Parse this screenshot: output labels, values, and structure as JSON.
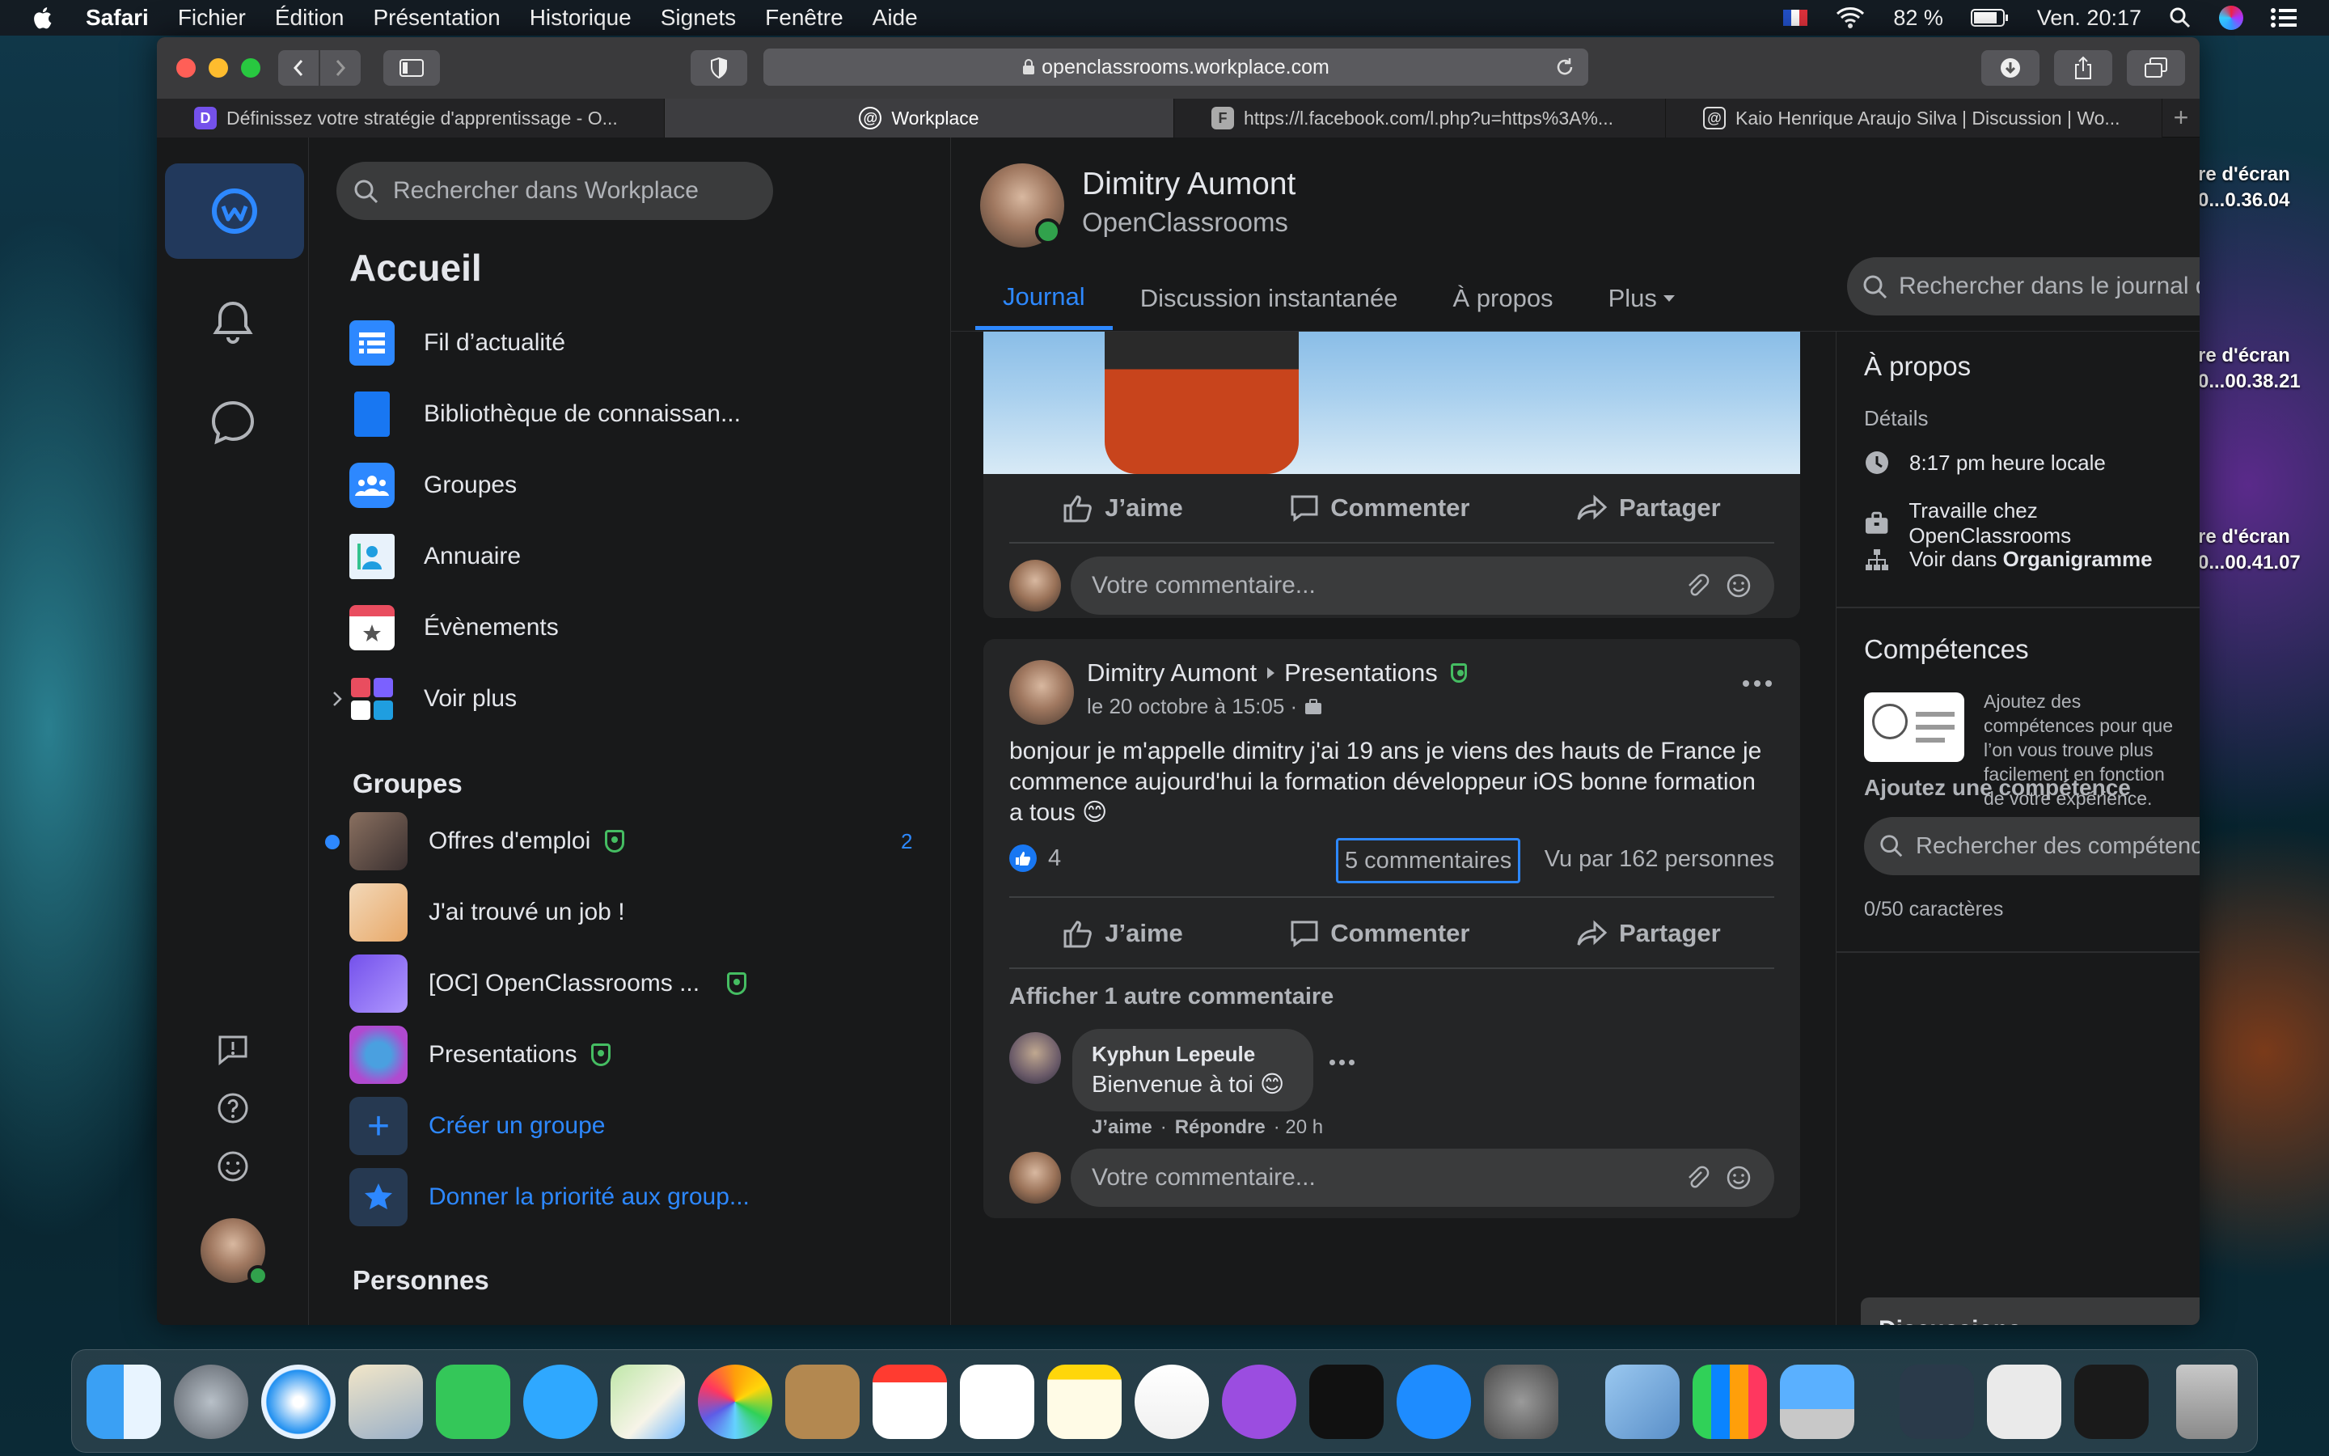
{
  "menubar": {
    "app": "Safari",
    "items": [
      "Fichier",
      "Édition",
      "Présentation",
      "Historique",
      "Signets",
      "Fenêtre",
      "Aide"
    ],
    "battery": "82 %",
    "clock": "Ven. 20:17"
  },
  "browser": {
    "url": "openclassrooms.workplace.com",
    "tabs": [
      {
        "label": "Définissez votre stratégie d'apprentissage - O...",
        "icon": "openclassrooms-favicon",
        "active": false
      },
      {
        "label": "Workplace",
        "icon": "workplace-favicon",
        "active": true
      },
      {
        "label": "https://l.facebook.com/l.php?u=https%3A%...",
        "icon": "facebook-favicon",
        "active": false
      },
      {
        "label": "Kaio Henrique Araujo Silva | Discussion | Wo...",
        "icon": "workplace-favicon",
        "active": false
      }
    ]
  },
  "left": {
    "search_placeholder": "Rechercher dans Workplace",
    "home_title": "Accueil",
    "nav": [
      "Fil d’actualité",
      "Bibliothèque de connaissan...",
      "Groupes",
      "Annuaire",
      "Évènements",
      "Voir plus"
    ],
    "groups_title": "Groupes",
    "groups": [
      {
        "name": "Offres d'emploi",
        "count": "2"
      },
      {
        "name": "J'ai trouvé un job !"
      },
      {
        "name": "[OC] OpenClassrooms ..."
      },
      {
        "name": "Presentations"
      }
    ],
    "create_group": "Créer un groupe",
    "prioritize": "Donner la priorité aux group...",
    "people_title": "Personnes"
  },
  "profile": {
    "name": "Dimitry Aumont",
    "org": "OpenClassrooms",
    "tabs": [
      "Journal",
      "Discussion instantanée",
      "À propos",
      "Plus"
    ],
    "search_placeholder": "Rechercher dans le journal de Dimitry"
  },
  "post1": {
    "like": "J’aime",
    "comment": "Commenter",
    "share": "Partager",
    "comment_placeholder": "Votre commentaire..."
  },
  "post2": {
    "author": "Dimitry Aumont",
    "group": "Presentations",
    "date": "le 20 octobre à 15:05 ·",
    "text": "bonjour je m'appelle dimitry j'ai 19 ans je viens des hauts de France je commence aujourd'hui la formation développeur iOS bonne formation a tous 😊",
    "likes": "4",
    "comments_count": "5 commentaires",
    "views": "Vu par 162 personnes",
    "like": "J’aime",
    "comment": "Commenter",
    "share": "Partager",
    "more_comments": "Afficher 1 autre commentaire",
    "reply": {
      "author": "Kyphun Lepeule",
      "text": "Bienvenue à toi 😊",
      "like": "J’aime",
      "answer": "Répondre",
      "time": "· 20 h"
    },
    "comment_placeholder": "Votre commentaire..."
  },
  "about": {
    "title": "À propos",
    "details": "Détails",
    "local_time": "8:17 pm heure locale",
    "works": "Travaille chez OpenClassrooms",
    "org_prefix": "Voir dans",
    "org_link": "Organigramme",
    "skills_title": "Compétences",
    "skills_text": "Ajoutez des compétences pour que l’on vous trouve plus facilement en fonction de votre expérience.",
    "add_skill": "Ajoutez une compétence",
    "skill_search": "Rechercher des compétences",
    "chars": "0/50 caractères",
    "discussions": "Discussions"
  },
  "desktop": {
    "labels": [
      "re d'écran\n0...0.36.04",
      "re d'écran\n0...00.38.21",
      "re d'écran\n0...00.41.07"
    ]
  },
  "colors": {
    "accent": "#2d88ff",
    "green": "#45bd62",
    "bg": "#18191a",
    "card": "#242526"
  }
}
